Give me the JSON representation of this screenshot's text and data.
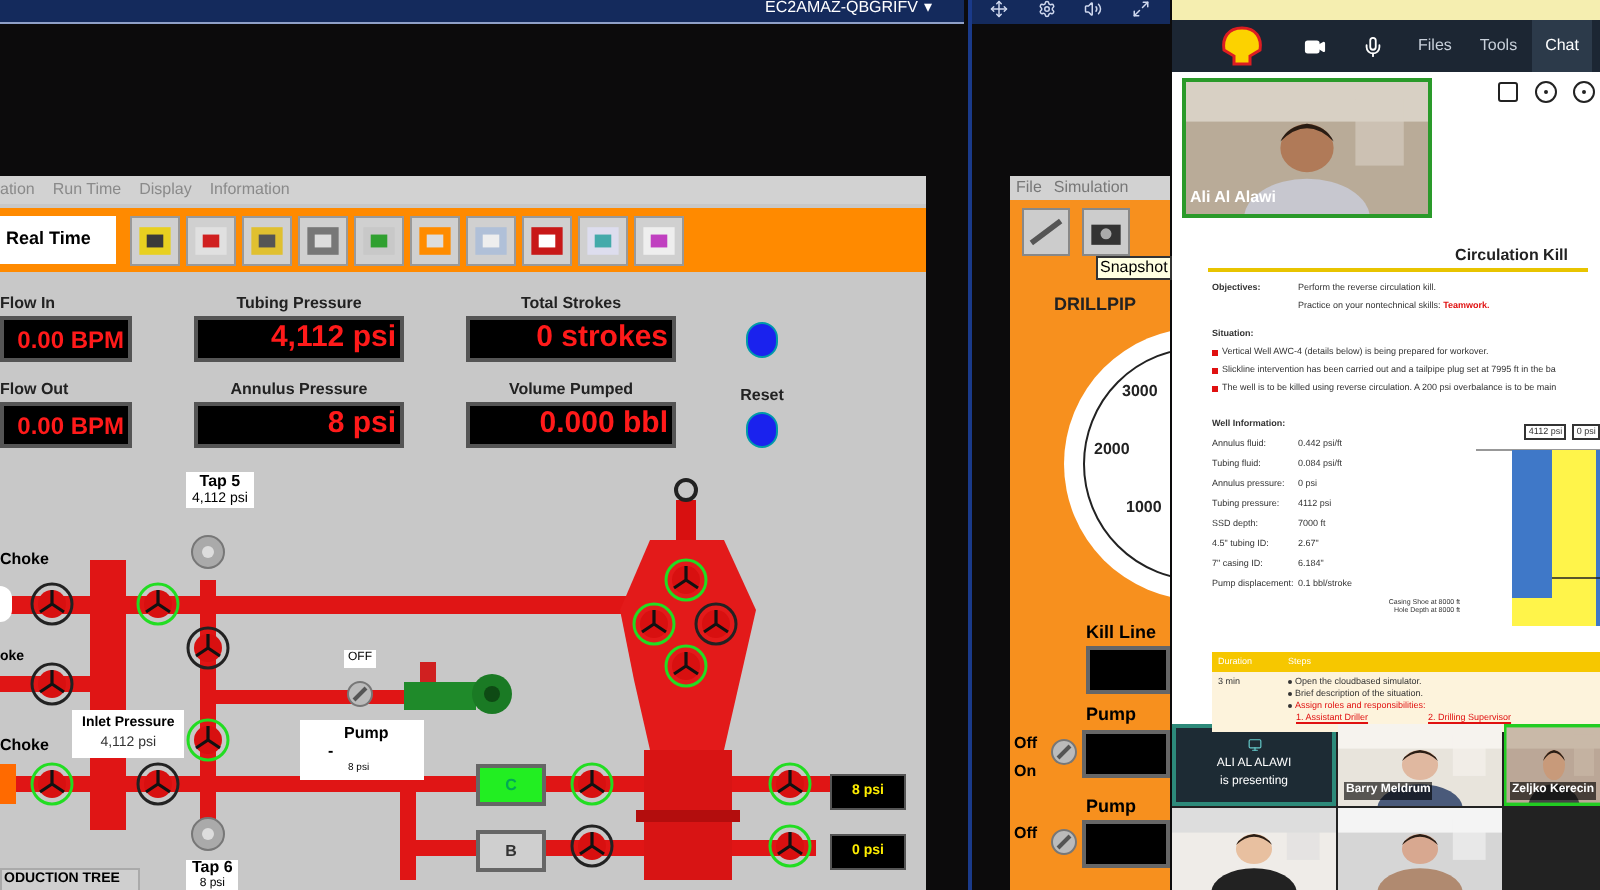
{
  "top_bar": {
    "machine_name": "EC2AMAZ-QBGRIFV",
    "chevron": "▾"
  },
  "simulator": {
    "menu": [
      "ation",
      "Run Time",
      "Display",
      "Information"
    ],
    "mode": "Real Time",
    "readouts": [
      {
        "label": "Flow In",
        "value": "0.00 BPM"
      },
      {
        "label": "Tubing Pressure",
        "value": "4,112 psi"
      },
      {
        "label": "Total Strokes",
        "value": "0 strokes"
      },
      {
        "label": "Flow Out",
        "value": "0.00 BPM"
      },
      {
        "label": "Annulus Pressure",
        "value": "8 psi"
      },
      {
        "label": "Volume Pumped",
        "value": "0.000 bbl"
      }
    ],
    "reset_label": "Reset",
    "diagram": {
      "tap_top": {
        "title": "Tap 5",
        "value": "4,112 psi"
      },
      "tap_bottom": {
        "title": "Tap 6",
        "value": "8 psi"
      },
      "choke_labels": [
        "Choke",
        "oke",
        "Choke"
      ],
      "pump_state": "OFF",
      "inlet": {
        "title": "Inlet Pressure",
        "value": "4,112 psi"
      },
      "pump": {
        "title": "Pump",
        "dash": "-",
        "value": "8 psi"
      },
      "lines": [
        {
          "label": "C",
          "selected": true,
          "reading": "8 psi"
        },
        {
          "label": "B",
          "selected": false,
          "reading": "0 psi"
        }
      ],
      "tree_label": "ODUCTION TREE",
      "valves": [
        {
          "open": false
        },
        {
          "open": true
        },
        {
          "open": false
        },
        {
          "open": true
        },
        {
          "open": false
        },
        {
          "open": true
        },
        {
          "open": false
        },
        {
          "open": true
        },
        {
          "open": true
        },
        {
          "open": false
        },
        {
          "open": true
        },
        {
          "open": true
        },
        {
          "open": true
        },
        {
          "open": false
        },
        {
          "open": true
        }
      ]
    }
  },
  "simulator2": {
    "menu": [
      "File",
      "Simulation"
    ],
    "tooltip": "Snapshot",
    "gauge_title": "DRILLPIP",
    "gauge_ticks": [
      "3000",
      "2000",
      "1000"
    ],
    "kill_line": "Kill Line",
    "pumps": [
      {
        "title": "Pump",
        "switch_labels": [
          "Off",
          "On"
        ]
      },
      {
        "title": "Pump",
        "switch_labels": [
          "Off"
        ]
      }
    ]
  },
  "meeting": {
    "nav": [
      {
        "label": "Files",
        "selected": false
      },
      {
        "label": "Tools",
        "selected": false
      },
      {
        "label": "Chat",
        "selected": true
      }
    ],
    "speaker_name": "Ali Al Alawi",
    "document": {
      "title": "Circulation Kill",
      "objectives_label": "Objectives:",
      "objectives": [
        "Perform the reverse circulation kill."
      ],
      "teamwork_text": "Practice on your nontechnical skills:",
      "teamwork_highlight": "Teamwork.",
      "situation_label": "Situation:",
      "situation": [
        "Vertical Well AWC-4 (details below) is being prepared for workover.",
        "Slickline intervention has been carried out and a tailpipe plug set at 7995 ft in the ba",
        "The well is to be killed using reverse circulation. A 200 psi overbalance is to be main"
      ],
      "well_label": "Well Information:",
      "well_info": [
        {
          "name": "Annulus fluid:",
          "value": "0.442 psi/ft"
        },
        {
          "name": "Tubing fluid:",
          "value": "0.084 psi/ft"
        },
        {
          "name": "Annulus pressure:",
          "value": "0 psi"
        },
        {
          "name": "Tubing pressure:",
          "value": "4112 psi"
        },
        {
          "name": "SSD depth:",
          "value": "7000 ft"
        },
        {
          "name": "4.5\" tubing ID:",
          "value": "2.67\""
        },
        {
          "name": "7\" casing ID:",
          "value": "6.184\""
        },
        {
          "name": "Pump displacement:",
          "value": "0.1 bbl/stroke"
        }
      ],
      "schematic": {
        "tubing_label": "4112 psi",
        "annulus_label": "0 psi",
        "shoe": "Casing Shoe at 8000 ft",
        "hole": "Hole Depth at 8000 ft"
      },
      "table": {
        "headers": [
          "Duration",
          "Steps"
        ],
        "duration": "3 min",
        "steps": [
          {
            "text": "Open the cloudbased simulator.",
            "emphasis": false
          },
          {
            "text": "Brief description of the situation.",
            "emphasis": false
          },
          {
            "text": "Assign roles and responsibilities:",
            "emphasis": true
          }
        ],
        "roles": [
          "1. Assistant Driller",
          "2. Drilling Supervisor"
        ]
      }
    },
    "presenter": {
      "name": "ALI AL ALAWI",
      "status": "is presenting"
    },
    "participants": [
      {
        "name": "Barry Meldrum",
        "speaking": false
      },
      {
        "name": "Zeljko Kerecin",
        "speaking": true
      },
      {
        "speaking": false
      },
      {
        "speaking": false
      }
    ]
  }
}
